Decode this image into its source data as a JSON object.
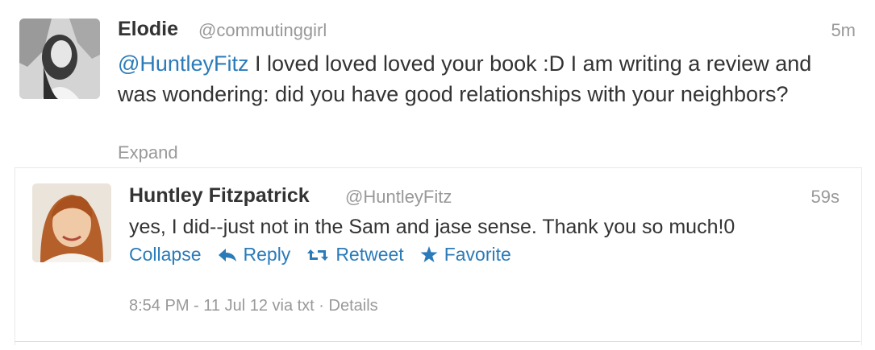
{
  "tweet1": {
    "name": "Elodie",
    "handle": "@commutinggirl",
    "time": "5m",
    "mention": "@HuntleyFitz",
    "text": " I loved loved loved your book :D I am writing a review and was wondering: did you have good relationships with your neighbors?",
    "expand_label": "Expand",
    "avatar_icon": "profile-photo"
  },
  "tweet2": {
    "name": "Huntley Fitzpatrick",
    "handle": "@HuntleyFitz",
    "time": "59s",
    "text": "yes, I did--just not in the Sam and jase sense. Thank you so much!0",
    "avatar_icon": "profile-photo",
    "actions": {
      "collapse": "Collapse",
      "reply": "Reply",
      "retweet": "Retweet",
      "favorite": "Favorite"
    },
    "meta": {
      "timestamp": "8:54 PM - 11 Jul 12 via txt",
      "separator": " · ",
      "details": "Details"
    }
  },
  "colors": {
    "link": "#2b7bb9",
    "muted": "#999999",
    "text": "#333333"
  }
}
